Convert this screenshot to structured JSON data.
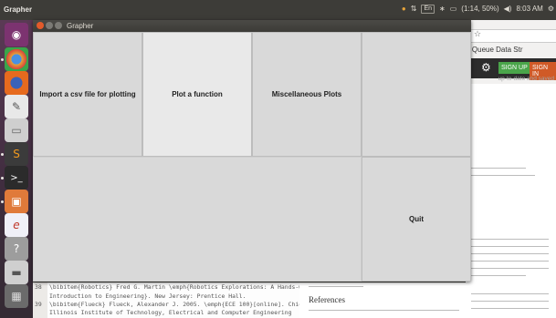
{
  "panel": {
    "app_title": "Grapher",
    "battery": "(1:14, 50%)",
    "time": "8:03 AM",
    "keyboard": "En"
  },
  "launcher": {
    "items": [
      {
        "icon": "ubuntu-dash-icon",
        "color": "#8a3a78",
        "glyph": "◉"
      },
      {
        "icon": "chrome-icon",
        "color": "#3c7ac8",
        "glyph": "●"
      },
      {
        "icon": "firefox-icon",
        "color": "#e66a1e",
        "glyph": "●"
      },
      {
        "icon": "text-editor-icon",
        "color": "#6a6a6a",
        "glyph": "✎"
      },
      {
        "icon": "file-manager-icon",
        "color": "#8c8c8c",
        "glyph": "▭"
      },
      {
        "icon": "sublime-text-icon",
        "color": "#4a4a4a",
        "glyph": "S"
      },
      {
        "icon": "terminal-icon",
        "color": "#2e2e2e",
        "glyph": ">_"
      },
      {
        "icon": "screenshot-icon",
        "color": "#d96a3a",
        "glyph": "▣"
      },
      {
        "icon": "eclipse-icon",
        "color": "#e8e8f4",
        "glyph": "e"
      },
      {
        "icon": "help-icon",
        "color": "#9a9a9a",
        "glyph": "?"
      },
      {
        "icon": "drive-icon",
        "color": "#bdbdbd",
        "glyph": "▬"
      },
      {
        "icon": "workspace-switcher-icon",
        "color": "#5e5e5e",
        "glyph": "▦"
      }
    ]
  },
  "browser": {
    "tab_label": "Queue Data Str",
    "signup": "SIGN UP",
    "signin": "SIGN IN",
    "save_status": "up-to-date and saved",
    "references": "References"
  },
  "editor": {
    "lines": [
      {
        "num": "38",
        "text": "\\bibitem{Robotics} Fred G. Martin \\emph{Robotics Explorations: A Hands-On"
      },
      {
        "num": "",
        "text": "Introduction to Engineering}. New Jersey: Prentice Hall."
      },
      {
        "num": "39",
        "text": "\\bibitem{Flueck} Flueck, Alexander J. 2005. \\emph{ECE 100}[online]. Chicago:"
      },
      {
        "num": "",
        "text": "Illinois Institute of Technology, Electrical and Computer Engineering"
      }
    ]
  },
  "dialog": {
    "title": "Grapher",
    "buttons": {
      "import_csv": "Import a csv file for plotting",
      "plot_function": "Plot a function",
      "misc_plots": "Miscellaneous Plots",
      "quit": "Quit"
    }
  }
}
